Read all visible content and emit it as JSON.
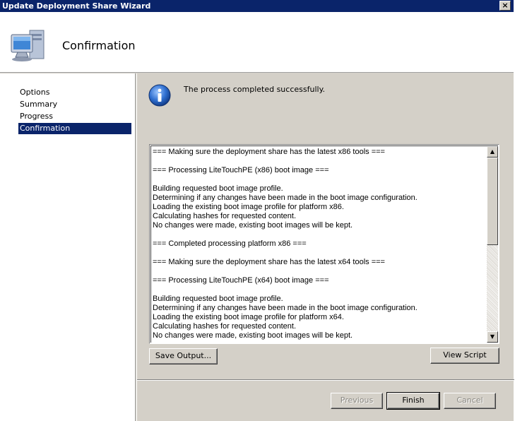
{
  "window": {
    "title": "Update Deployment Share Wizard",
    "close_glyph": "×"
  },
  "header": {
    "title": "Confirmation",
    "icon": "computer-icon"
  },
  "nav": {
    "items": [
      {
        "label": "Options"
      },
      {
        "label": "Summary"
      },
      {
        "label": "Progress"
      },
      {
        "label": "Confirmation",
        "active": true
      }
    ]
  },
  "status": {
    "icon": "info-icon",
    "message": "The process completed successfully."
  },
  "output": {
    "lines": [
      "=== Making sure the deployment share has the latest x86 tools ===",
      "",
      "=== Processing LiteTouchPE (x86) boot image ===",
      "",
      "Building requested boot image profile.",
      "Determining if any changes have been made in the boot image configuration.",
      "Loading the existing boot image profile for platform x86.",
      "Calculating hashes for requested content.",
      "No changes were made, existing boot images will be kept.",
      "",
      "=== Completed processing platform x86 ===",
      "",
      "=== Making sure the deployment share has the latest x64 tools ===",
      "",
      "=== Processing LiteTouchPE (x64) boot image ===",
      "",
      "Building requested boot image profile.",
      "Determining if any changes have been made in the boot image configuration.",
      "Loading the existing boot image profile for platform x64.",
      "Calculating hashes for requested content.",
      "No changes were made, existing boot images will be kept."
    ]
  },
  "buttons": {
    "save_output": "Save Output...",
    "view_script": "View Script",
    "previous": "Previous",
    "finish": "Finish",
    "cancel": "Cancel"
  },
  "colors": {
    "titlebar": "#0a246a",
    "selection": "#0a246a",
    "face": "#d4d0c8",
    "info_blue": "#1f5fbf"
  }
}
